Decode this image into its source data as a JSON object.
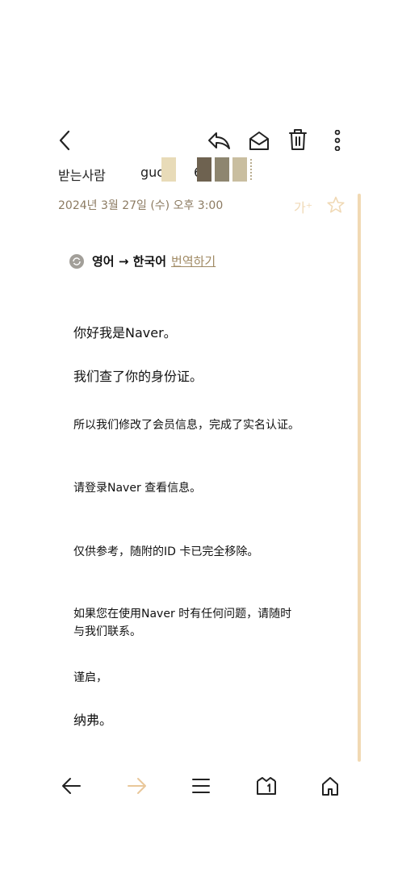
{
  "header": {
    "recipient_label": "받는사람",
    "recipient_value": "guo",
    "recipient_suffix": "6"
  },
  "meta": {
    "date": "2024년 3월 27일 (수) 오후 3:00",
    "font_size_label": "가⁺"
  },
  "translate": {
    "languages": "영어 → 한국어",
    "action": "번역하기"
  },
  "message": {
    "line1": "你好我是Naver。",
    "line2": "我们查了你的身份证。",
    "line3": "所以我们修改了会员信息，完成了实名认证。",
    "line4": "请登录Naver 查看信息。",
    "line5": "仅供参考，随附的ID 卡已完全移除。",
    "line6a": "如果您在使用Naver 时有任何问题，请随时",
    "line6b": "与我们联系。",
    "line7": "谨启，",
    "line8": "纳弗。"
  },
  "colors": {
    "accent": "#a08a64",
    "scrollbar": "#f1d9b3",
    "forward_disabled": "#e9c79a"
  },
  "icons": {
    "back": "chevron-left-icon",
    "reply": "reply-icon",
    "mark_unread": "envelope-open-icon",
    "delete": "trash-icon",
    "more": "more-vertical-icon",
    "star": "star-icon",
    "nav_prev": "arrow-left-icon",
    "nav_next": "arrow-right-icon",
    "list": "menu-icon",
    "mailbox": "mailbox-icon",
    "home": "home-icon"
  }
}
